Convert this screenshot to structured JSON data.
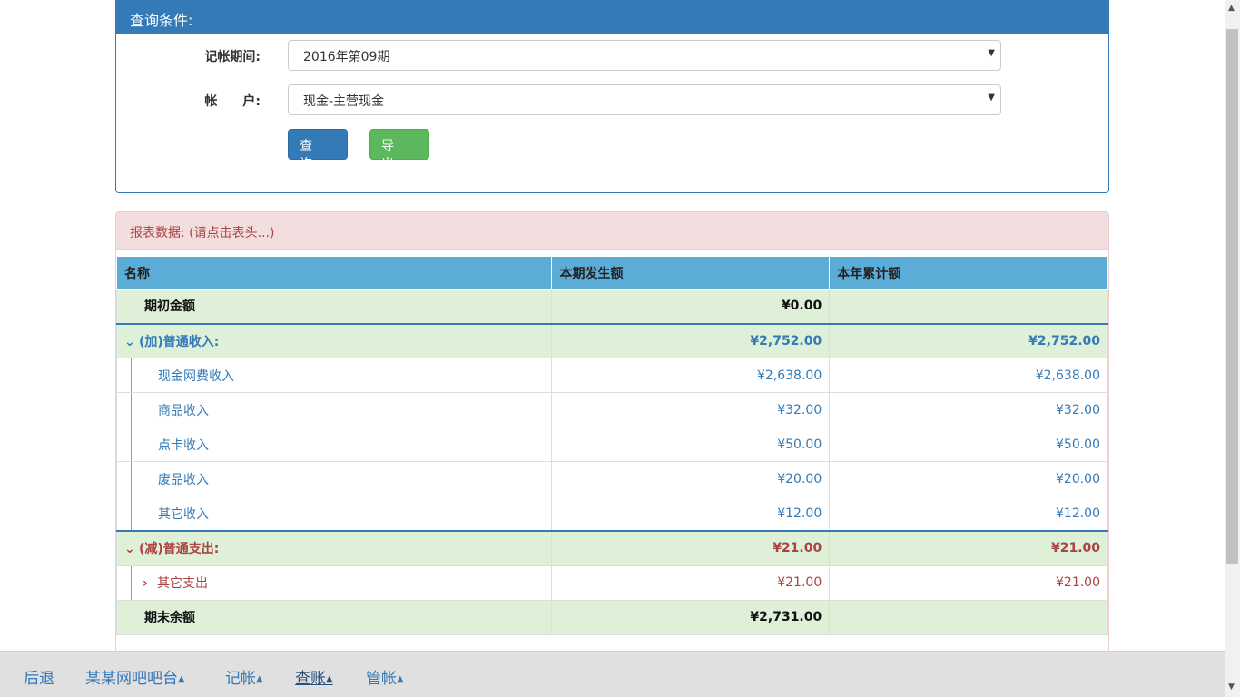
{
  "query": {
    "title": "查询条件:",
    "period_label": "记帐期间:",
    "period_value": "2016年第09期",
    "account_label": "帐　　户:",
    "account_value": "现金-主营现金",
    "query_button": "查询...",
    "export_button": "导出..."
  },
  "report": {
    "title": "报表数据: (请点击表头...)",
    "columns": [
      "名称",
      "本期发生额",
      "本年累计额"
    ],
    "opening": {
      "name": "期初金额",
      "current": "¥0.00",
      "ytd": ""
    },
    "income_group": {
      "name": "(加)普通收入:",
      "current": "¥2,752.00",
      "ytd": "¥2,752.00"
    },
    "income_items": [
      {
        "name": "现金网费收入",
        "current": "¥2,638.00",
        "ytd": "¥2,638.00"
      },
      {
        "name": "商品收入",
        "current": "¥32.00",
        "ytd": "¥32.00"
      },
      {
        "name": "点卡收入",
        "current": "¥50.00",
        "ytd": "¥50.00"
      },
      {
        "name": "废品收入",
        "current": "¥20.00",
        "ytd": "¥20.00"
      },
      {
        "name": "其它收入",
        "current": "¥12.00",
        "ytd": "¥12.00"
      }
    ],
    "expense_group": {
      "name": "(减)普通支出:",
      "current": "¥21.00",
      "ytd": "¥21.00"
    },
    "expense_items": [
      {
        "name": "其它支出",
        "current": "¥21.00",
        "ytd": "¥21.00"
      }
    ],
    "closing": {
      "name": "期末余额",
      "current": "¥2,731.00",
      "ytd": ""
    }
  },
  "nav": {
    "back": "后退",
    "home": "某某网吧吧台",
    "bookkeeping": "记帐",
    "audit": "查账",
    "manage": "管帐"
  },
  "colors": {
    "primary": "#337ab7",
    "success": "#5cb85c",
    "danger_text": "#a94442",
    "danger_bg": "#f2dede",
    "header_bg": "#5bacd6",
    "group_bg": "#dff0d8"
  },
  "icons": {
    "expand": "chevron-down-icon",
    "collapsed": "chevron-right-icon",
    "dropdown": "caret-down-icon"
  }
}
